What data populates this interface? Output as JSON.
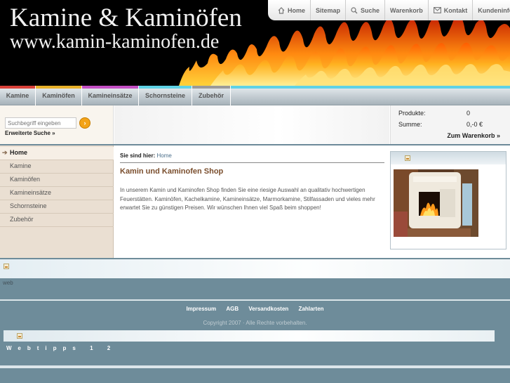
{
  "header": {
    "title": "Kamine & Kaminöfen",
    "url": "www.kamin-kaminofen.de"
  },
  "topnav": [
    {
      "label": "Home",
      "icon": "home-icon"
    },
    {
      "label": "Sitemap"
    },
    {
      "label": "Suche",
      "icon": "search-icon"
    },
    {
      "label": "Warenkorb"
    },
    {
      "label": "Kontakt",
      "icon": "mail-icon"
    },
    {
      "label": "Kundeninfo"
    }
  ],
  "categories": [
    {
      "label": "Kamine",
      "color": "#d9413a"
    },
    {
      "label": "Kaminöfen",
      "color": "#e8b12a"
    },
    {
      "label": "Kamineinsätze",
      "color": "#c44fc4"
    },
    {
      "label": "Schornsteine",
      "color": "#5fd2e6"
    },
    {
      "label": "Zubehör",
      "color": "#9a9a9a"
    }
  ],
  "search": {
    "placeholder": "Suchbegriff eingeben",
    "advanced_label": "Erweiterte Suche »"
  },
  "cart": {
    "products_label": "Produkte:",
    "products_value": "0",
    "sum_label": "Summe:",
    "sum_value": "0,-0 €",
    "link_label": "Zum Warenkorb »"
  },
  "sidebar": {
    "items": [
      {
        "label": "Home",
        "active": true
      },
      {
        "label": "Kamine"
      },
      {
        "label": "Kaminöfen"
      },
      {
        "label": "Kamineinsätze"
      },
      {
        "label": "Schornsteine"
      },
      {
        "label": "Zubehör"
      }
    ]
  },
  "main": {
    "breadcrumb_label": "Sie sind hier:",
    "breadcrumb_link": "Home",
    "heading": "Kamin und Kaminofen Shop",
    "body": "In unserem Kamin und Kaminofen Shop finden Sie eine riesige Auswahl an qualitativ hochwertigen Feuerstätten. Kaminöfen, Kachelkamine, Kamineinsätze, Marmorkamine, Stilfassaden und vieles mehr erwartet Sie zu günstigen Preisen. Wir wünschen Ihnen viel Spaß beim shoppen!"
  },
  "footer": {
    "web_text": "web",
    "links": [
      "Impressum",
      "AGB",
      "Versandkosten",
      "Zahlarten"
    ],
    "copyright": "Copyright 2007 · Alle Rechte vorbehalten.",
    "webtipps": "Webtipps 1 2"
  }
}
